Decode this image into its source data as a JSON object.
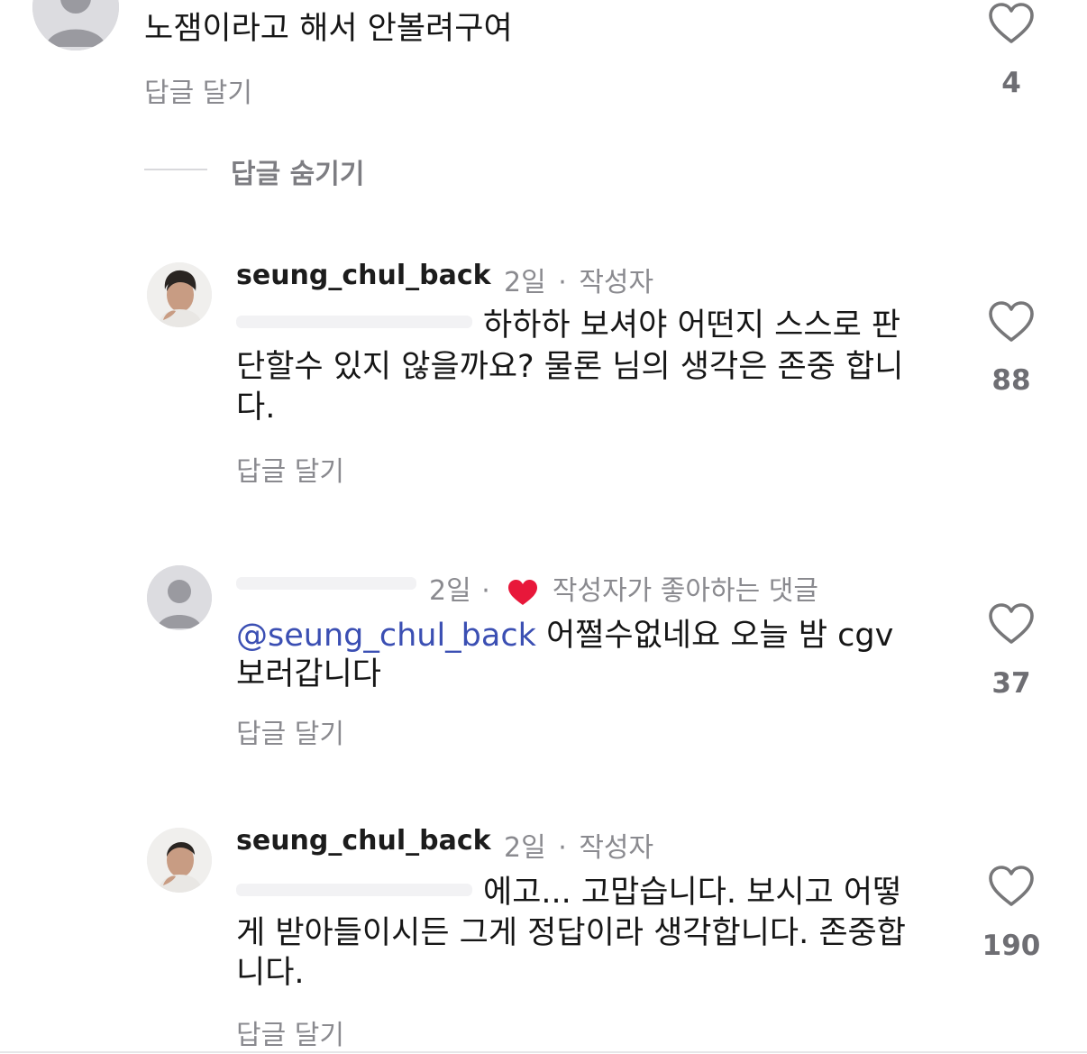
{
  "comments": [
    {
      "text": "노잼이라고 해서 안볼려구여",
      "reply_label": "답글 달기",
      "likes": "4"
    },
    {
      "username": "seung_chul_back",
      "time": "2일",
      "separator": "·",
      "badge": "작성자",
      "text_line1": "하하하 보셔야 어떤지 스스로 판",
      "text_line2": "단할수 있지 않을까요? 물론 님의 생각은 존중 합니",
      "text_line3": "다.",
      "reply_label": "답글 달기",
      "likes": "88"
    },
    {
      "time": "2일",
      "separator": "·",
      "liked_by_author": "작성자가 좋아하는 댓글",
      "mention": "@seung_chul_back",
      "text_line1_rest": " 어쩔수없네요 오늘 밤 cgv",
      "text_line2": "보러갑니다",
      "reply_label": "답글 달기",
      "likes": "37"
    },
    {
      "username": "seung_chul_back",
      "time": "2일",
      "separator": "·",
      "badge": "작성자",
      "text_line1": "에고... 고맙습니다. 보시고 어떻",
      "text_line2": "게 받아들이시든 그게 정답이라 생각합니다. 존중합",
      "text_line3": "니다.",
      "reply_label": "답글 달기",
      "likes": "190"
    }
  ],
  "hide_replies_label": "답글 숨기기",
  "icons": {
    "like": "heart-outline-icon",
    "liked": "heart-filled-icon",
    "avatar_default": "default-avatar-icon"
  },
  "colors": {
    "mention": "#3b4fb3",
    "liked_heart": "#e8173a",
    "secondary_text": "#8a8a8f"
  }
}
